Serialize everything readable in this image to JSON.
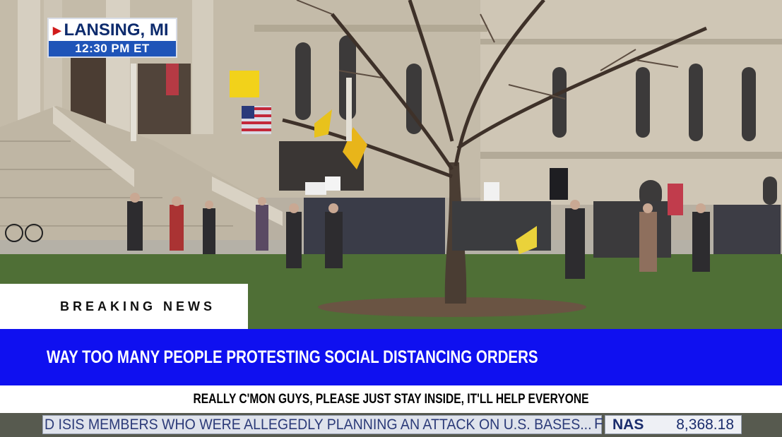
{
  "location": {
    "place": "LANSING, MI",
    "time": "12:30 PM ET"
  },
  "breaking": {
    "label": "BREAKING NEWS",
    "headline": "WAY TOO MANY PEOPLE PROTESTING SOCIAL DISTANCING ORDERS",
    "subheadline": "REALLY C'MON GUYS, PLEASE JUST STAY INSIDE, IT'LL HELP EVERYONE"
  },
  "ticker": {
    "crawl": "D ISIS MEMBERS WHO WERE ALLEGEDLY PLANNING AN ATTACK ON U.S. BASES...",
    "separator": "F",
    "stock_symbol": "NAS",
    "stock_value": "8,368.18"
  },
  "colors": {
    "headline_blue": "#0f10f0",
    "location_navy": "#0d2b6d",
    "time_bar_blue": "#1f54b8"
  }
}
